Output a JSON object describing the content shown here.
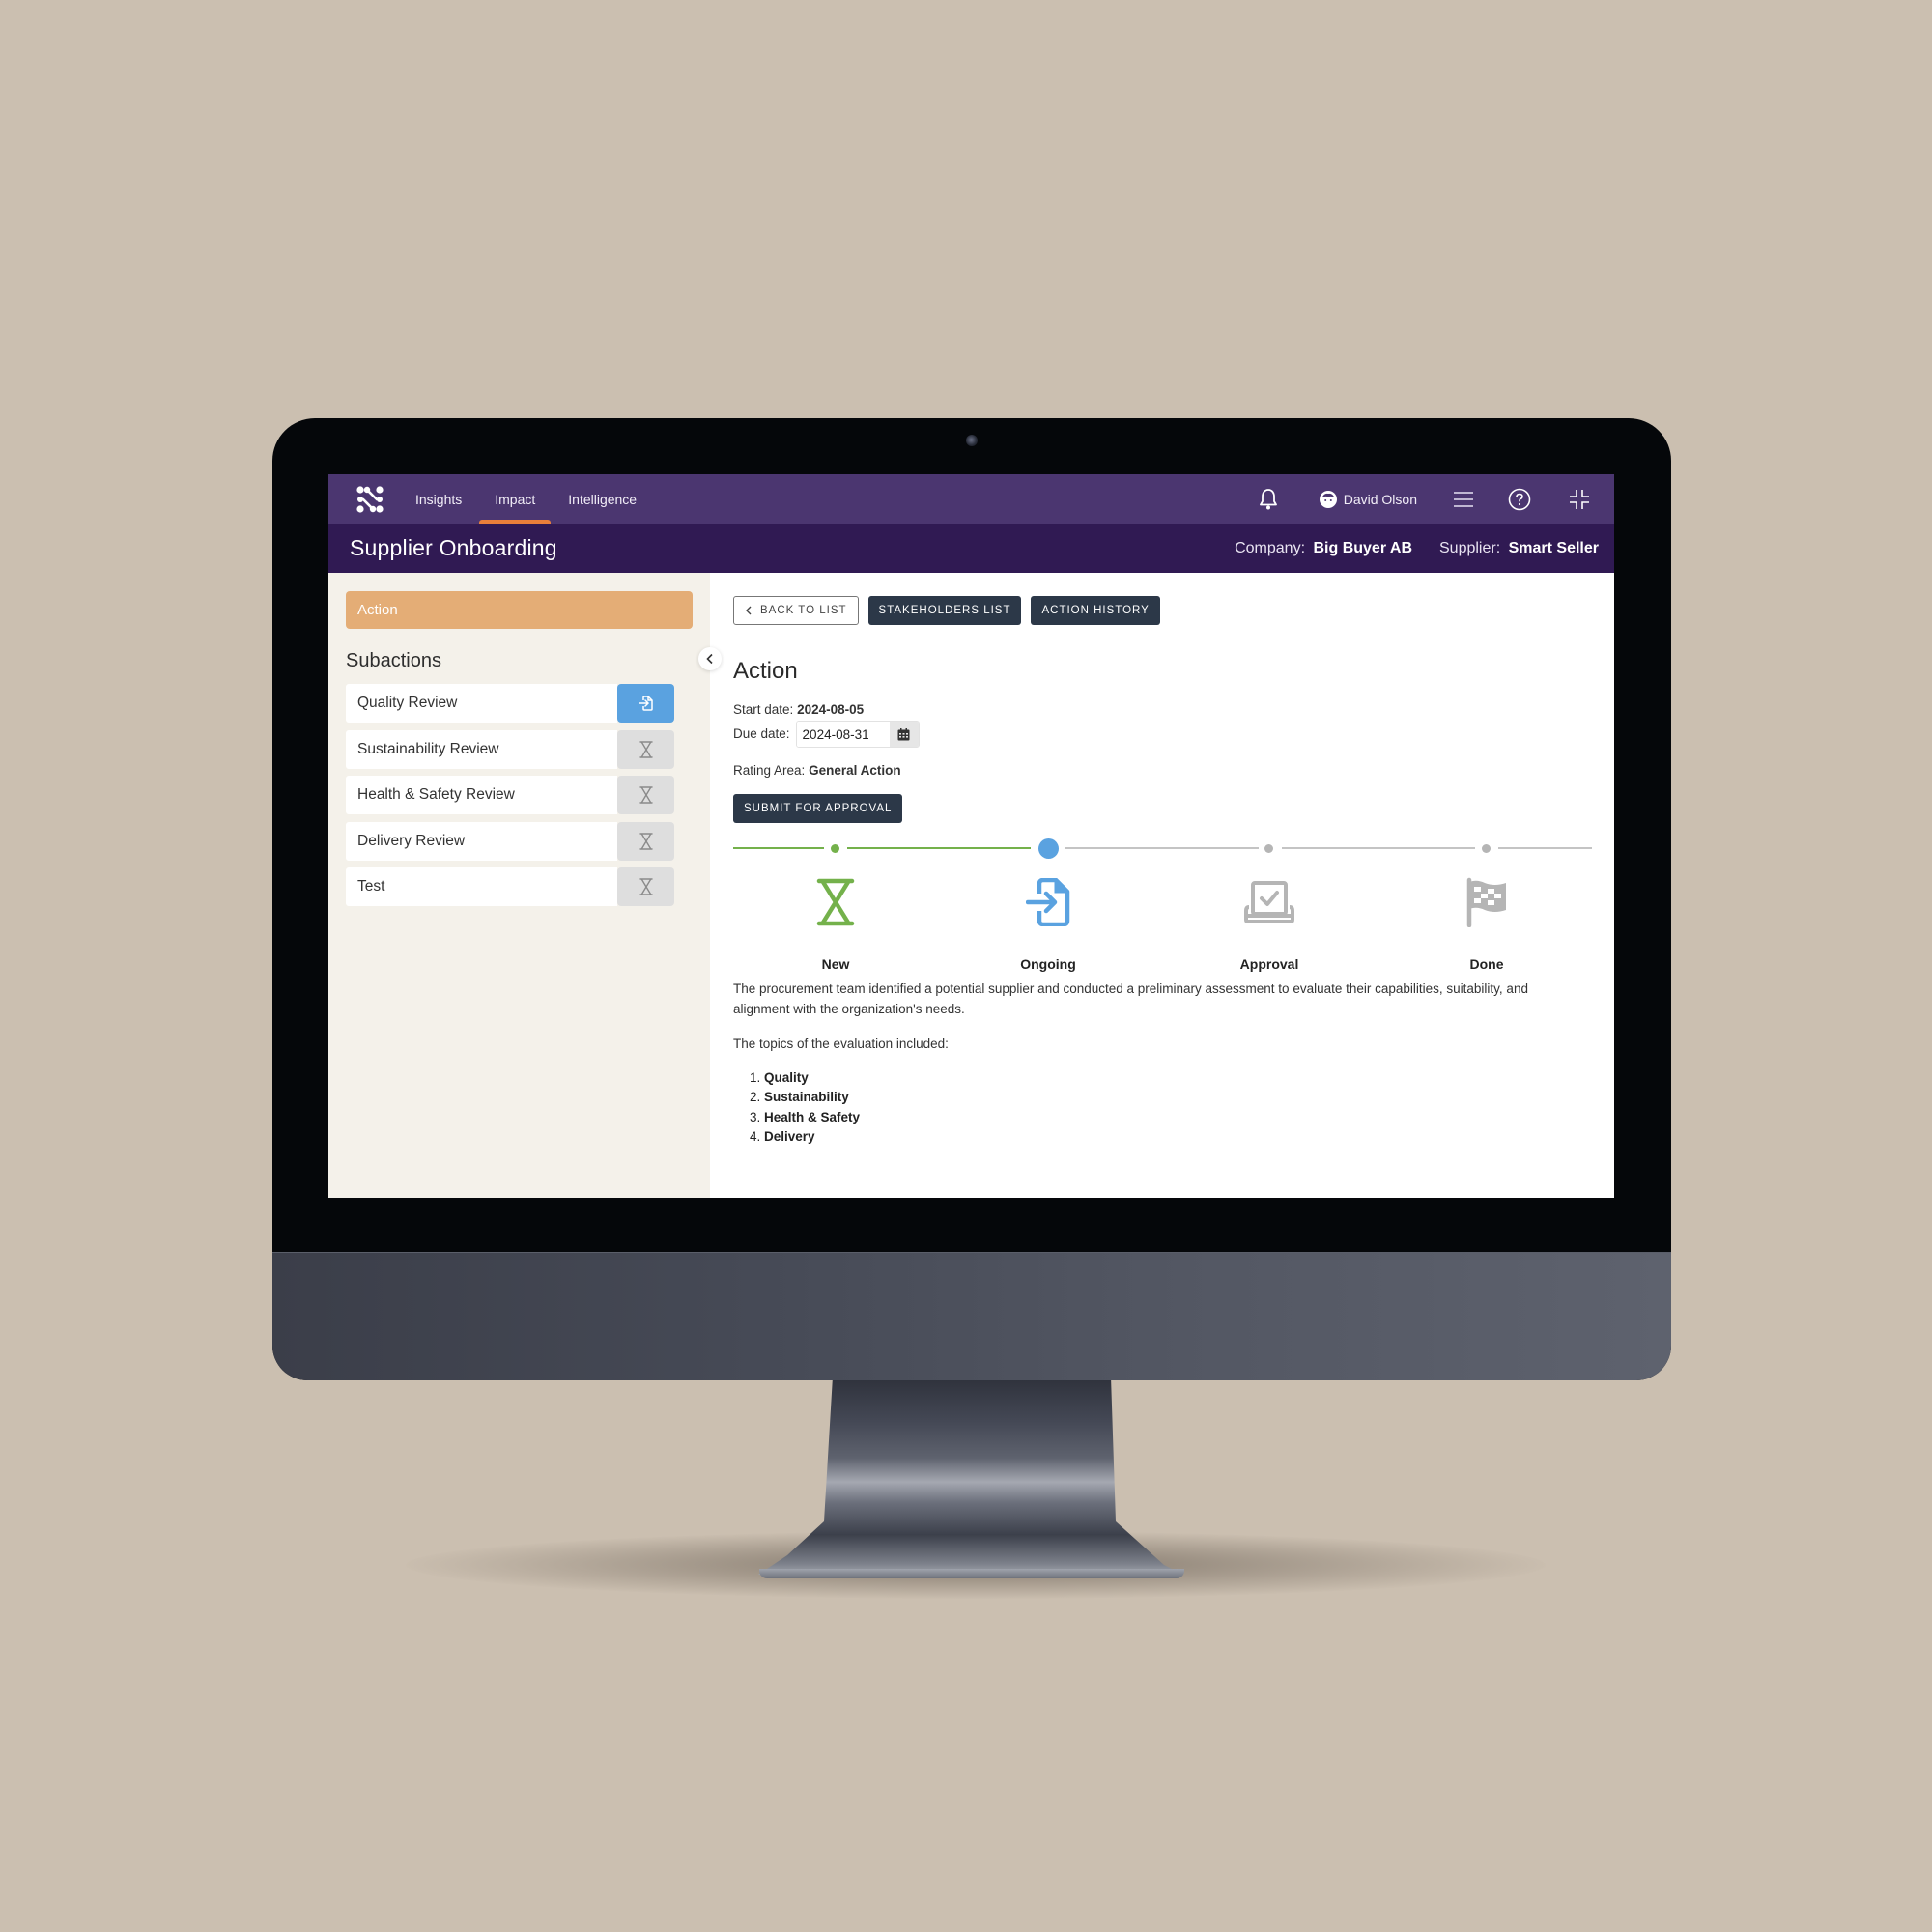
{
  "nav": {
    "items": [
      {
        "label": "Insights",
        "active": false
      },
      {
        "label": "Impact",
        "active": true
      },
      {
        "label": "Intelligence",
        "active": false
      }
    ],
    "user_name": "David Olson",
    "icons": [
      "bell-icon",
      "user-avatar-icon",
      "hamburger-menu-icon",
      "help-icon",
      "collapse-fullscreen-icon"
    ]
  },
  "header": {
    "title": "Supplier Onboarding",
    "company_label": "Company:",
    "company_value": "Big Buyer AB",
    "supplier_label": "Supplier:",
    "supplier_value": "Smart Seller"
  },
  "sidebar": {
    "action_label": "Action",
    "subactions_title": "Subactions",
    "subactions": [
      {
        "label": "Quality Review",
        "status": "ongoing",
        "icon": "file-import-icon"
      },
      {
        "label": "Sustainability Review",
        "status": "new",
        "icon": "hourglass-icon"
      },
      {
        "label": "Health & Safety Review",
        "status": "new",
        "icon": "hourglass-icon"
      },
      {
        "label": "Delivery Review",
        "status": "new",
        "icon": "hourglass-icon"
      },
      {
        "label": "Test",
        "status": "new",
        "icon": "hourglass-icon"
      }
    ]
  },
  "main": {
    "buttons": {
      "back": "Back to list",
      "stakeholders": "Stakeholders list",
      "history": "Action history",
      "submit": "Submit for approval"
    },
    "title": "Action",
    "start_date_label": "Start date:",
    "start_date": "2024-08-05",
    "due_date_label": "Due date:",
    "due_date": "2024-08-31",
    "rating_label": "Rating Area:",
    "rating_value": "General Action",
    "stepper": {
      "current_step": 2,
      "steps": [
        {
          "label": "New",
          "state": "done",
          "icon": "hourglass-icon"
        },
        {
          "label": "Ongoing",
          "state": "current",
          "icon": "file-import-icon"
        },
        {
          "label": "Approval",
          "state": "pending",
          "icon": "approval-checkbox-icon"
        },
        {
          "label": "Done",
          "state": "pending",
          "icon": "flag-icon"
        }
      ]
    },
    "description": [
      "The procurement team identified a potential supplier and conducted a preliminary assessment to evaluate their capabilities, suitability, and alignment with the organization's needs.",
      "The topics of the evaluation included:"
    ],
    "topics": [
      "Quality",
      "Sustainability",
      "Health & Safety",
      "Delivery"
    ]
  },
  "colors": {
    "topbar": "#4b3670",
    "subbar": "#301a53",
    "nav_active_underline": "#e97f3a",
    "action_bar": "#e4ad76",
    "sidebar_bg": "#f4f1ea",
    "done_green": "#74b14b",
    "current_blue": "#5aa2e0",
    "pending_grey": "#b5b5b5",
    "dark_button": "#2c3848"
  }
}
